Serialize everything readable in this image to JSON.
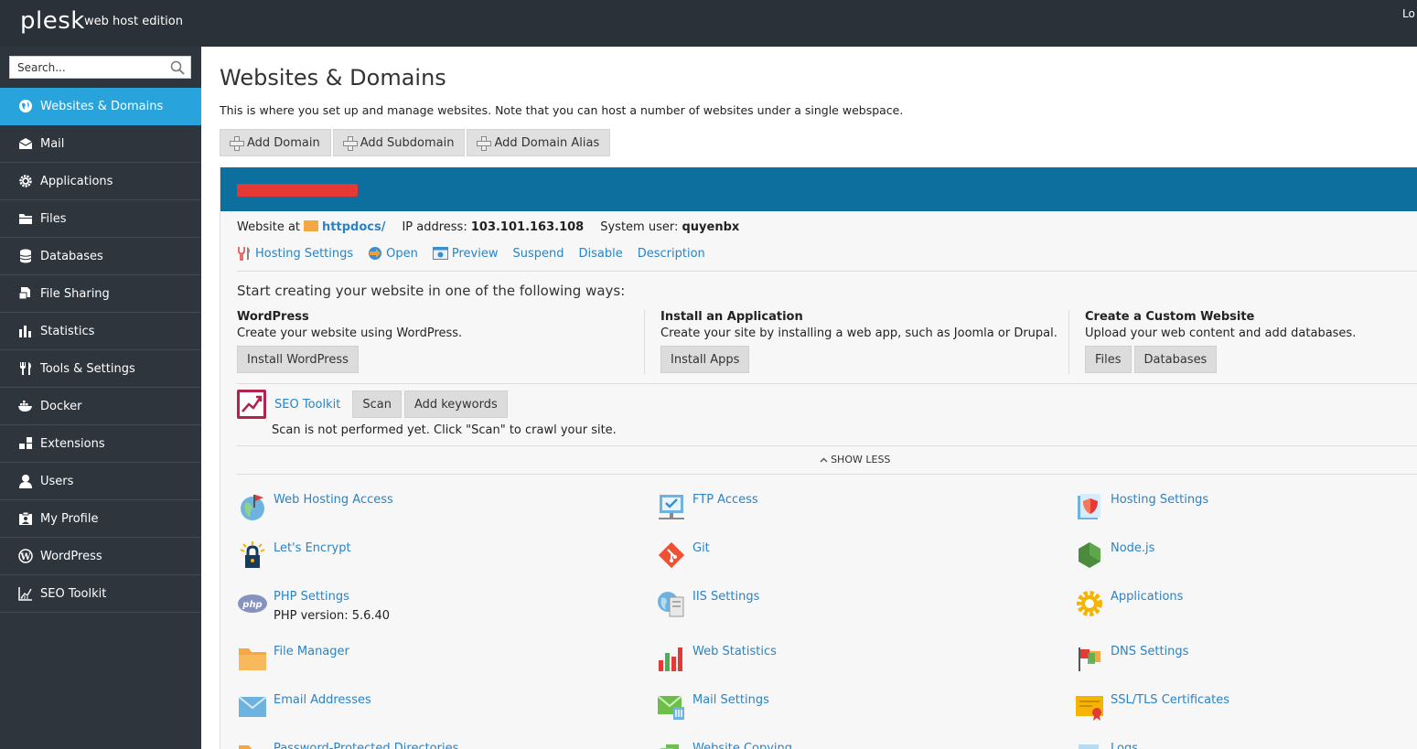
{
  "app": {
    "logo": "plesk",
    "edition": "web host edition",
    "topright_label": "Lo"
  },
  "search": {
    "placeholder": "Search..."
  },
  "sidebar": {
    "items": [
      {
        "label": "Websites & Domains",
        "icon": "globe-icon",
        "active": true
      },
      {
        "label": "Mail",
        "icon": "mail-icon"
      },
      {
        "label": "Applications",
        "icon": "gear-icon"
      },
      {
        "label": "Files",
        "icon": "folder-icon"
      },
      {
        "label": "Databases",
        "icon": "database-icon"
      },
      {
        "label": "File Sharing",
        "icon": "file-sharing-icon"
      },
      {
        "label": "Statistics",
        "icon": "bar-chart-icon"
      },
      {
        "label": "Tools & Settings",
        "icon": "tools-icon"
      },
      {
        "label": "Docker",
        "icon": "docker-icon"
      },
      {
        "label": "Extensions",
        "icon": "extensions-icon"
      },
      {
        "label": "Users",
        "icon": "user-icon"
      },
      {
        "label": "My Profile",
        "icon": "profile-icon"
      },
      {
        "label": "WordPress",
        "icon": "wordpress-icon"
      },
      {
        "label": "SEO Toolkit",
        "icon": "seo-chart-icon"
      }
    ]
  },
  "main": {
    "title": "Websites & Domains",
    "description": "This is where you set up and manage websites. Note that you can host a number of websites under a single webspace.",
    "toolbar": {
      "add_domain": "Add Domain",
      "add_subdomain": "Add Subdomain",
      "add_alias": "Add Domain Alias"
    }
  },
  "domain": {
    "name_redacted": "",
    "website_at_label": "Website at",
    "docroot": "httpdocs/",
    "ip_label": "IP address:",
    "ip": "103.101.163.108",
    "sysuser_label": "System user:",
    "sysuser": "quyenbx",
    "links": {
      "hosting_settings": "Hosting Settings",
      "open": "Open",
      "preview": "Preview",
      "suspend": "Suspend",
      "disable": "Disable",
      "description": "Description"
    },
    "start_title": "Start creating your website in one of the following ways:",
    "wordpress": {
      "title": "WordPress",
      "desc": "Create your website using WordPress.",
      "button": "Install WordPress"
    },
    "app": {
      "title": "Install an Application",
      "desc": "Create your site by installing a web app, such as Joomla or Drupal.",
      "button": "Install Apps"
    },
    "custom": {
      "title": "Create a Custom Website",
      "desc": "Upload your web content and add databases.",
      "files_button": "Files",
      "db_button": "Databases"
    },
    "seo": {
      "label": "SEO Toolkit",
      "scan": "Scan",
      "add_keywords": "Add keywords",
      "note": "Scan is not performed yet. Click \"Scan\" to crawl your site."
    },
    "show_less": "SHOW LESS",
    "tools": {
      "web_hosting_access": "Web Hosting Access",
      "ftp_access": "FTP Access",
      "hosting_settings": "Hosting Settings",
      "lets_encrypt": "Let's Encrypt",
      "git": "Git",
      "nodejs": "Node.js",
      "php_settings": "PHP Settings",
      "php_version": "PHP version: 5.6.40",
      "iis_settings": "IIS Settings",
      "applications": "Applications",
      "file_manager": "File Manager",
      "web_statistics": "Web Statistics",
      "dns_settings": "DNS Settings",
      "email_addresses": "Email Addresses",
      "mail_settings": "Mail Settings",
      "ssl_tls": "SSL/TLS Certificates",
      "password_protected": "Password-Protected Directories",
      "website_copying": "Website Copying",
      "logs": "Logs"
    }
  },
  "colors": {
    "sidebar_bg": "#2f353d",
    "topbar_bg": "#2b3138",
    "active_nav": "#28a3dc",
    "domain_header": "#0d6f9e",
    "link": "#2a83c6"
  }
}
